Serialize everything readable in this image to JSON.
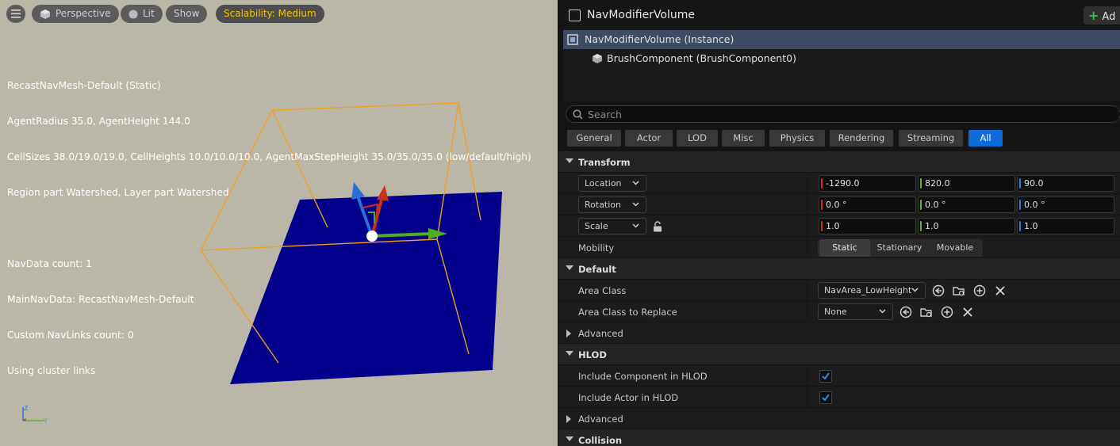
{
  "viewport": {
    "toolbar": {
      "menu_icon": "hamburger-icon",
      "perspective_label": "Perspective",
      "lit_label": "Lit",
      "show_label": "Show",
      "scalability_label": "Scalability: Medium"
    },
    "stats": {
      "line1": "RecastNavMesh-Default (Static)",
      "line2": "AgentRadius 35.0, AgentHeight 144.0",
      "line3": "CellSizes 38.0/19.0/19.0, CellHeights 10.0/10.0/10.0, AgentMaxStepHeight 35.0/35.0/35.0 (low/default/high)",
      "line4": "Region part Watershed, Layer part Watershed",
      "line5": "NavData count: 1",
      "line6": "MainNavData: RecastNavMesh-Default",
      "line7": "Custom NavLinks count: 0",
      "line8": "Using cluster links"
    },
    "colors": {
      "background": "#bab6a8",
      "navmesh": "#02008a",
      "volume": "#f0a020"
    }
  },
  "details": {
    "title": "NavModifierVolume",
    "add_label": "Ad",
    "components": [
      {
        "label": "NavModifierVolume (Instance)",
        "selected": true
      },
      {
        "label": "BrushComponent (BrushComponent0)",
        "selected": false
      }
    ],
    "search_placeholder": "Search",
    "filters": [
      "General",
      "Actor",
      "LOD",
      "Misc",
      "Physics",
      "Rendering",
      "Streaming",
      "All"
    ],
    "active_filter": "All",
    "transform": {
      "category": "Transform",
      "location_label": "Location",
      "rotation_label": "Rotation",
      "scale_label": "Scale",
      "location": [
        "-1290.0",
        "820.0",
        "90.0"
      ],
      "rotation": [
        "0.0 °",
        "0.0 °",
        "0.0 °"
      ],
      "scale": [
        "1.0",
        "1.0",
        "1.0"
      ],
      "mobility_label": "Mobility",
      "mobility_options": [
        "Static",
        "Stationary",
        "Movable"
      ],
      "mobility_selected": "Static"
    },
    "default": {
      "category": "Default",
      "area_class_label": "Area Class",
      "area_class_value": "NavArea_LowHeight",
      "area_class_replace_label": "Area Class to Replace",
      "area_class_replace_value": "None",
      "advanced_label": "Advanced"
    },
    "hlod": {
      "category": "HLOD",
      "include_component_label": "Include Component in HLOD",
      "include_component": true,
      "include_actor_label": "Include Actor in HLOD",
      "include_actor": true,
      "advanced_label": "Advanced"
    },
    "collision": {
      "category": "Collision"
    },
    "axis_colors": {
      "x": "#d62d20",
      "y": "#5fb82a",
      "z": "#2d7ee0"
    }
  }
}
